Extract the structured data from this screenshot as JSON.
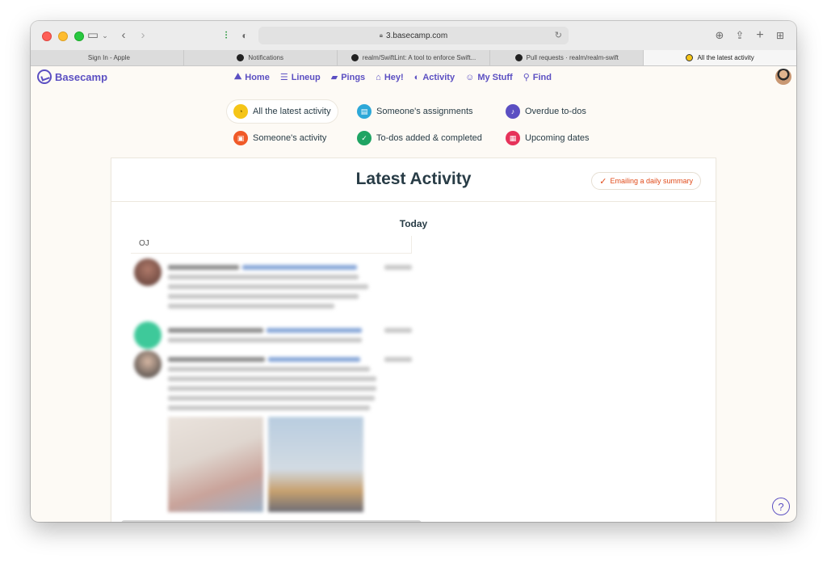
{
  "browser": {
    "url": "3.basecamp.com",
    "tabs": [
      {
        "label": "Sign In - Apple",
        "icon": "apple-icon"
      },
      {
        "label": "Notifications",
        "icon": "github-icon"
      },
      {
        "label": "realm/SwiftLint: A tool to enforce Swift...",
        "icon": "github-icon"
      },
      {
        "label": "Pull requests · realm/realm-swift",
        "icon": "github-icon"
      },
      {
        "label": "All the latest activity",
        "icon": "basecamp-icon"
      }
    ]
  },
  "nav": {
    "logo": "Basecamp",
    "links": [
      {
        "label": "Home",
        "icon": "mountain-icon"
      },
      {
        "label": "Lineup",
        "icon": "lineup-icon"
      },
      {
        "label": "Pings",
        "icon": "chat-icon"
      },
      {
        "label": "Hey!",
        "icon": "inbox-icon"
      },
      {
        "label": "Activity",
        "icon": "activity-icon"
      },
      {
        "label": "My Stuff",
        "icon": "smiley-icon"
      },
      {
        "label": "Find",
        "icon": "search-icon"
      }
    ]
  },
  "filters": [
    {
      "label": "All the latest activity",
      "icon": "clock-icon",
      "color": "#f5c518",
      "active": true
    },
    {
      "label": "Someone's assignments",
      "icon": "clipboard-icon",
      "color": "#2da8d8"
    },
    {
      "label": "Overdue to-dos",
      "icon": "bell-icon",
      "color": "#5b4fc2"
    },
    {
      "label": "Someone's activity",
      "icon": "briefcase-icon",
      "color": "#f05a28"
    },
    {
      "label": "To-dos added & completed",
      "icon": "check-icon",
      "color": "#1fa463"
    },
    {
      "label": "Upcoming dates",
      "icon": "calendar-icon",
      "color": "#e6335a"
    }
  ],
  "main": {
    "title": "Latest Activity",
    "email_button": "Emailing a daily summary",
    "day": "Today",
    "group": "OJ"
  },
  "help": "?"
}
